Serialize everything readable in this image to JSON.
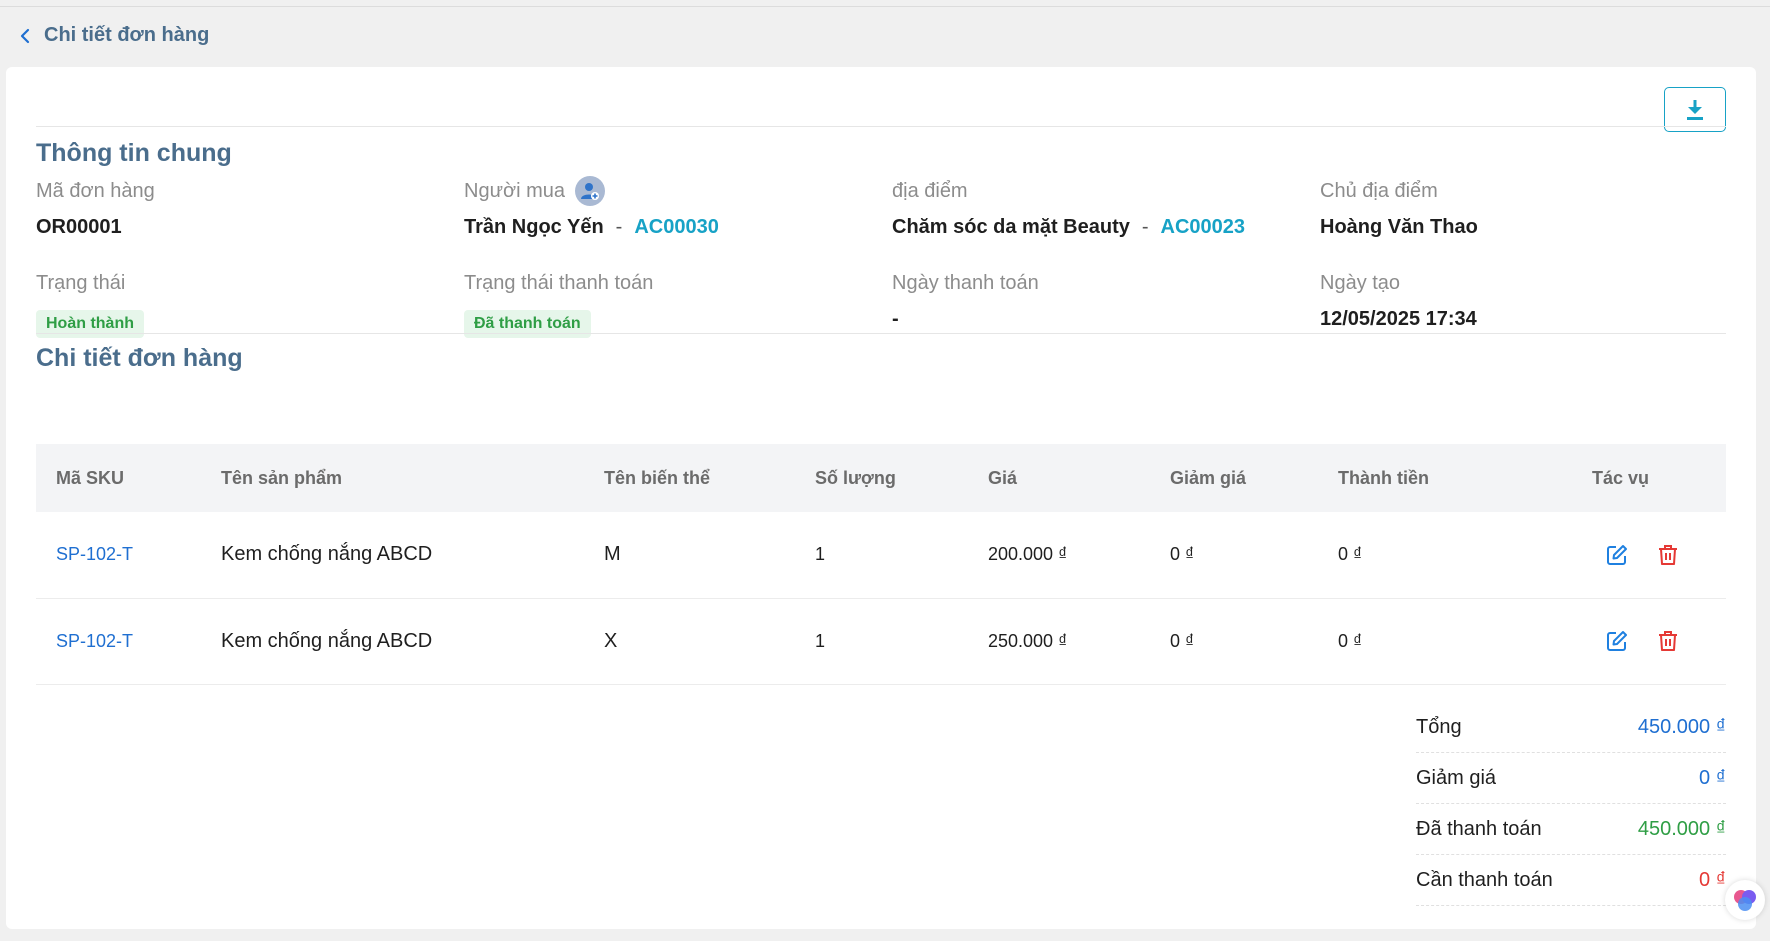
{
  "header": {
    "back_label": "Chi tiết đơn hàng"
  },
  "general": {
    "title": "Thông tin chung",
    "order_code_label": "Mã đơn hàng",
    "order_code": "OR00001",
    "buyer_label": "Người mua",
    "buyer_name": "Trần Ngọc Yến",
    "buyer_code": "AC00030",
    "location_label": "địa điểm",
    "location_name": "Chăm sóc da mặt Beauty",
    "location_code": "AC00023",
    "owner_label": "Chủ địa điểm",
    "owner_name": "Hoàng Văn Thao",
    "status_label": "Trạng thái",
    "status": "Hoàn thành",
    "payment_status_label": "Trạng thái thanh toán",
    "payment_status": "Đã thanh toán",
    "payment_date_label": "Ngày thanh toán",
    "payment_date": "-",
    "created_label": "Ngày tạo",
    "created_date": "12/05/2025 17:34",
    "dash": "-"
  },
  "details": {
    "title": "Chi tiết đơn hàng",
    "columns": [
      "Mã SKU",
      "Tên sản phẩm",
      "Tên biến thể",
      "Số lượng",
      "Giá",
      "Giảm giá",
      "Thành tiền",
      "Tác vụ"
    ],
    "rows": [
      {
        "sku": "SP-102-T",
        "name": "Kem chống nắng ABCD",
        "variant": "M",
        "qty": "1",
        "price": "200.000 ₫",
        "discount": "0 ₫",
        "total": "0 ₫"
      },
      {
        "sku": "SP-102-T",
        "name": "Kem chống nắng ABCD",
        "variant": "X",
        "qty": "1",
        "price": "250.000 ₫",
        "discount": "0 ₫",
        "total": "0 ₫"
      }
    ]
  },
  "summary": {
    "total_label": "Tổng",
    "total": "450.000 ₫",
    "discount_label": "Giảm giá",
    "discount": "0 ₫",
    "paid_label": "Đã thanh toán",
    "paid": "450.000 ₫",
    "due_label": "Cần thanh toán",
    "due": "0 ₫"
  },
  "colors": {
    "accent": "#17a2c6",
    "link": "#1f6fd1",
    "success": "#2f9e45",
    "danger": "#e53935",
    "heading": "#4a6d8c"
  },
  "icons": {
    "back": "chevron-left-icon",
    "download": "download-icon",
    "buyer": "user-plus-icon",
    "edit": "edit-icon",
    "delete": "trash-icon"
  }
}
